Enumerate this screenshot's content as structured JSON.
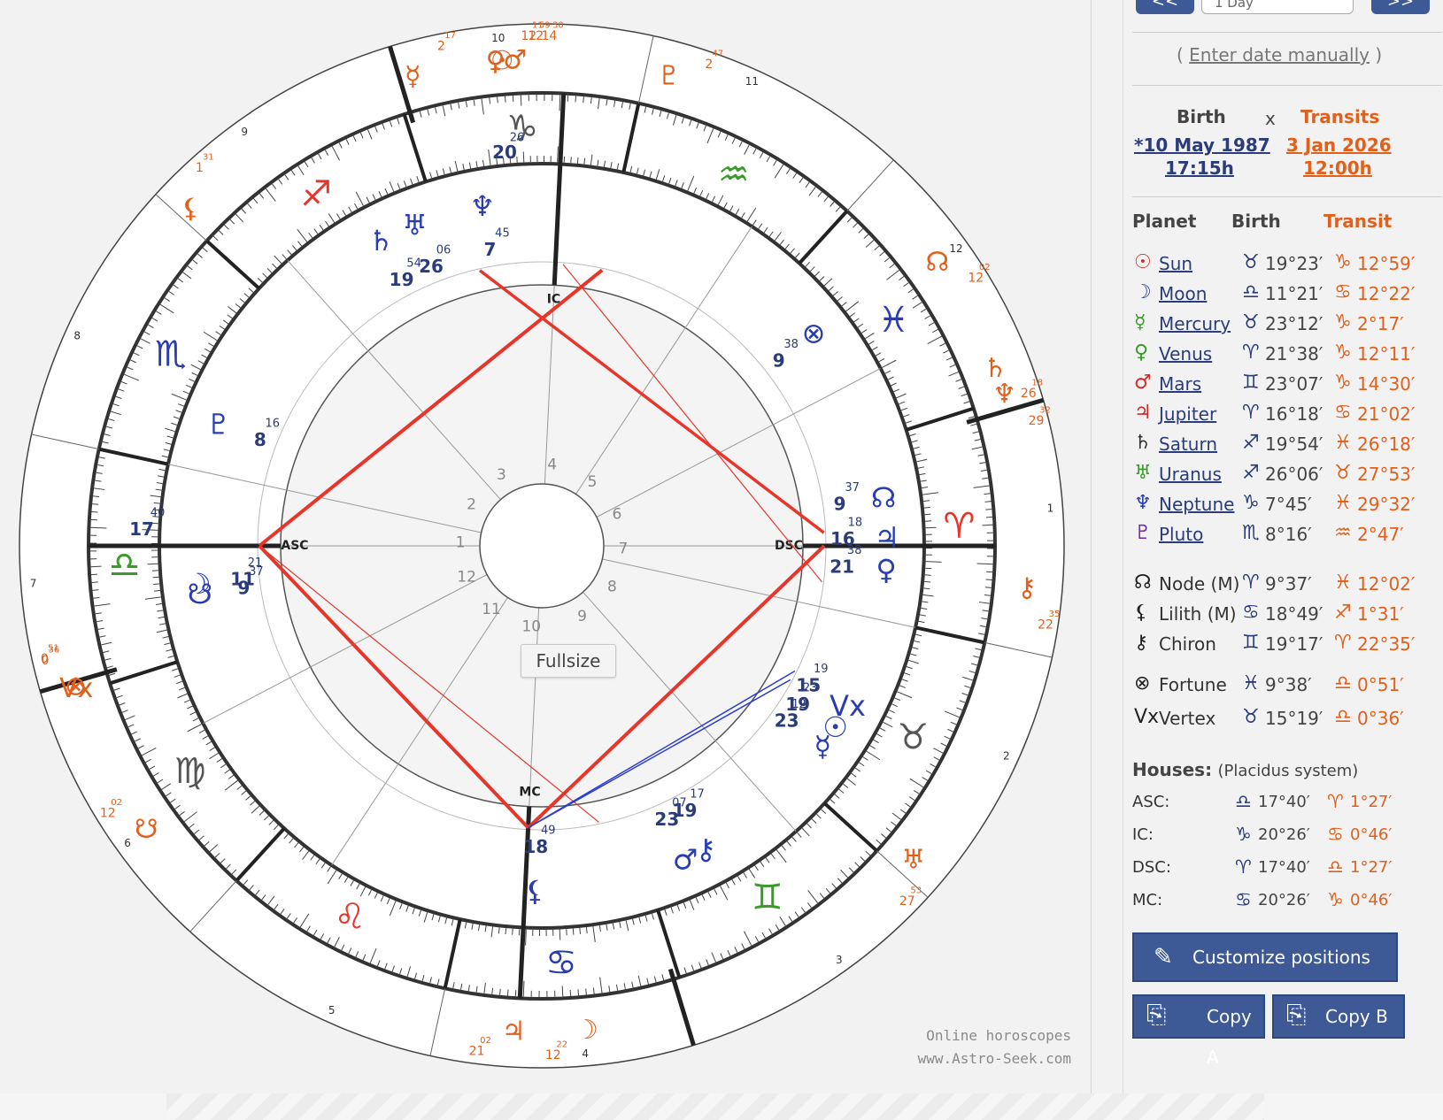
{
  "nav": {
    "prev_label": "<<",
    "next_label": ">>",
    "step_value": "1 Day",
    "enter_manually": "Enter date manually"
  },
  "header": {
    "birth_label": "Birth",
    "x_label": "x",
    "transits_label": "Transits",
    "birth_date": "*10 May 1987",
    "birth_time": "17:15h",
    "transit_date": "3 Jan 2026",
    "transit_time": "12:00h"
  },
  "table": {
    "col_planet": "Planet",
    "col_birth": "Birth",
    "col_transit": "Transit",
    "planets": [
      {
        "glyph": "☉",
        "name": "Sun",
        "bsign": "♉",
        "bval": "19°23′",
        "tsign": "♑",
        "tval": "12°59′",
        "color": "#d42a2a",
        "link": true
      },
      {
        "glyph": "☽",
        "name": "Moon",
        "bsign": "♎",
        "bval": "11°21′",
        "tsign": "♋",
        "tval": "12°22′",
        "color": "#2a3db0",
        "link": true
      },
      {
        "glyph": "☿",
        "name": "Mercury",
        "bsign": "♉",
        "bval": "23°12′",
        "tsign": "♑",
        "tval": "2°17′",
        "color": "#3a9a2a",
        "link": true
      },
      {
        "glyph": "♀",
        "name": "Venus",
        "bsign": "♈",
        "bval": "21°38′",
        "tsign": "♑",
        "tval": "12°11′",
        "color": "#3a9a2a",
        "link": true
      },
      {
        "glyph": "♂",
        "name": "Mars",
        "bsign": "♊",
        "bval": "23°07′",
        "tsign": "♑",
        "tval": "14°30′",
        "color": "#d42a2a",
        "link": true
      },
      {
        "glyph": "♃",
        "name": "Jupiter",
        "bsign": "♈",
        "bval": "16°18′",
        "tsign": "♋",
        "tval": "21°02′",
        "color": "#d42a2a",
        "link": true
      },
      {
        "glyph": "♄",
        "name": "Saturn",
        "bsign": "♐",
        "bval": "19°54′",
        "tsign": "♓",
        "tval": "26°18′",
        "color": "#333333",
        "link": true
      },
      {
        "glyph": "♅",
        "name": "Uranus",
        "bsign": "♐",
        "bval": "26°06′",
        "tsign": "♉",
        "tval": "27°53′",
        "color": "#3a9a2a",
        "link": true
      },
      {
        "glyph": "♆",
        "name": "Neptune",
        "bsign": "♑",
        "bval": "7°45′",
        "tsign": "♓",
        "tval": "29°32′",
        "color": "#2a3db0",
        "link": true
      },
      {
        "glyph": "♇",
        "name": "Pluto",
        "bsign": "♏",
        "bval": "8°16′",
        "tsign": "♒",
        "tval": "2°47′",
        "color": "#6a2ab0",
        "link": true
      }
    ],
    "points": [
      {
        "glyph": "☊",
        "name": "Node (M)",
        "bsign": "♈",
        "bval": "9°37′",
        "tsign": "♓",
        "tval": "12°02′"
      },
      {
        "glyph": "⚸",
        "name": "Lilith (M)",
        "bsign": "♋",
        "bval": "18°49′",
        "tsign": "♐",
        "tval": "1°31′"
      },
      {
        "glyph": "⚷",
        "name": "Chiron",
        "bsign": "♊",
        "bval": "19°17′",
        "tsign": "♈",
        "tval": "22°35′"
      }
    ],
    "extras": [
      {
        "glyph": "⊗",
        "name": "Fortune",
        "bsign": "♓",
        "bval": "9°38′",
        "tsign": "♎",
        "tval": "0°51′"
      },
      {
        "glyph": "Vx",
        "name": "Vertex",
        "bsign": "♉",
        "bval": "15°19′",
        "tsign": "♎",
        "tval": "0°36′"
      }
    ]
  },
  "houses": {
    "title": "Houses:",
    "system": "(Placidus system)",
    "rows": [
      {
        "label": "ASC:",
        "bsign": "♎",
        "bval": "17°40′",
        "tsign": "♈",
        "tval": "1°27′"
      },
      {
        "label": "IC:",
        "bsign": "♑",
        "bval": "20°26′",
        "tsign": "♋",
        "tval": "0°46′"
      },
      {
        "label": "DSC:",
        "bsign": "♈",
        "bval": "17°40′",
        "tsign": "♎",
        "tval": "1°27′"
      },
      {
        "label": "MC:",
        "bsign": "♋",
        "bval": "20°26′",
        "tsign": "♑",
        "tval": "0°46′"
      }
    ]
  },
  "buttons": {
    "customize": "Customize positions",
    "copy_a": "Copy A",
    "copy_b": "Copy B"
  },
  "chart": {
    "fullsize_label": "Fullsize",
    "watermark_line1": "Online horoscopes",
    "watermark_line2": "www.Astro-Seek.com",
    "house_numbers_inner": [
      "1",
      "2",
      "3",
      "4",
      "5",
      "6",
      "7",
      "8",
      "9",
      "10",
      "11",
      "12"
    ],
    "angle_labels": [
      "ASC",
      "DSC",
      "MC",
      "IC"
    ],
    "zodiac_signs": [
      "♈",
      "♉",
      "♊",
      "♋",
      "♌",
      "♍",
      "♎",
      "♏",
      "♐",
      "♑",
      "♒",
      "♓"
    ],
    "inner_planets": [
      {
        "glyph": "☽",
        "deg": "11",
        "min": "21"
      },
      {
        "glyph": "☋",
        "deg": "9",
        "min": "37"
      },
      {
        "glyph": "♇",
        "deg": "8",
        "min": "16"
      },
      {
        "glyph": "♄",
        "deg": "19",
        "min": "54"
      },
      {
        "glyph": "♅",
        "deg": "26",
        "min": "06"
      },
      {
        "glyph": "♆",
        "deg": "7",
        "min": "45"
      },
      {
        "glyph": "⊗",
        "deg": "9",
        "min": "38"
      },
      {
        "glyph": "♀",
        "deg": "21",
        "min": "38"
      },
      {
        "glyph": "♃",
        "deg": "16",
        "min": "18"
      },
      {
        "glyph": "☊",
        "deg": "9",
        "min": "37"
      },
      {
        "glyph": "Vx",
        "deg": "15",
        "min": "19"
      },
      {
        "glyph": "☉",
        "deg": "19",
        "min": "23"
      },
      {
        "glyph": "☿",
        "deg": "23",
        "min": "12"
      },
      {
        "glyph": "⚷",
        "deg": "19",
        "min": "17"
      },
      {
        "glyph": "♂",
        "deg": "23",
        "min": "07"
      },
      {
        "glyph": "⚸",
        "deg": "18",
        "min": "49"
      }
    ],
    "angle_degrees": [
      "17",
      "40",
      "20",
      "26"
    ],
    "outer_planets": [
      {
        "glyph": "♃",
        "deg": "21",
        "min": "02"
      },
      {
        "glyph": "☽",
        "deg": "12",
        "min": "22"
      },
      {
        "glyph": "♅",
        "deg": "27",
        "min": "53"
      },
      {
        "glyph": "⚷",
        "deg": "22",
        "min": "35"
      },
      {
        "glyph": "♆",
        "deg": "29",
        "min": "32"
      },
      {
        "glyph": "♄",
        "deg": "26",
        "min": "18"
      },
      {
        "glyph": "☊",
        "deg": "12",
        "min": "02"
      },
      {
        "glyph": "♇",
        "deg": "2",
        "min": "47"
      },
      {
        "glyph": "♂",
        "deg": "14",
        "min": "30"
      },
      {
        "glyph": "☉",
        "deg": "12",
        "min": "59"
      },
      {
        "glyph": "♀",
        "deg": "12",
        "min": "11"
      },
      {
        "glyph": "☿",
        "deg": "2",
        "min": "17"
      },
      {
        "glyph": "⚸",
        "deg": "1",
        "min": "31"
      },
      {
        "glyph": "⊗",
        "deg": "0",
        "min": "51"
      },
      {
        "glyph": "Vx",
        "deg": "0",
        "min": "36"
      },
      {
        "glyph": "☋",
        "deg": "12",
        "min": "02"
      }
    ]
  },
  "colors": {
    "accent": "#3d5a96",
    "birth_blue": "#2a3d7a",
    "transit_orange": "#e0601c",
    "aspect_red": "#e8352a",
    "aspect_blue": "#2a3dd0"
  }
}
